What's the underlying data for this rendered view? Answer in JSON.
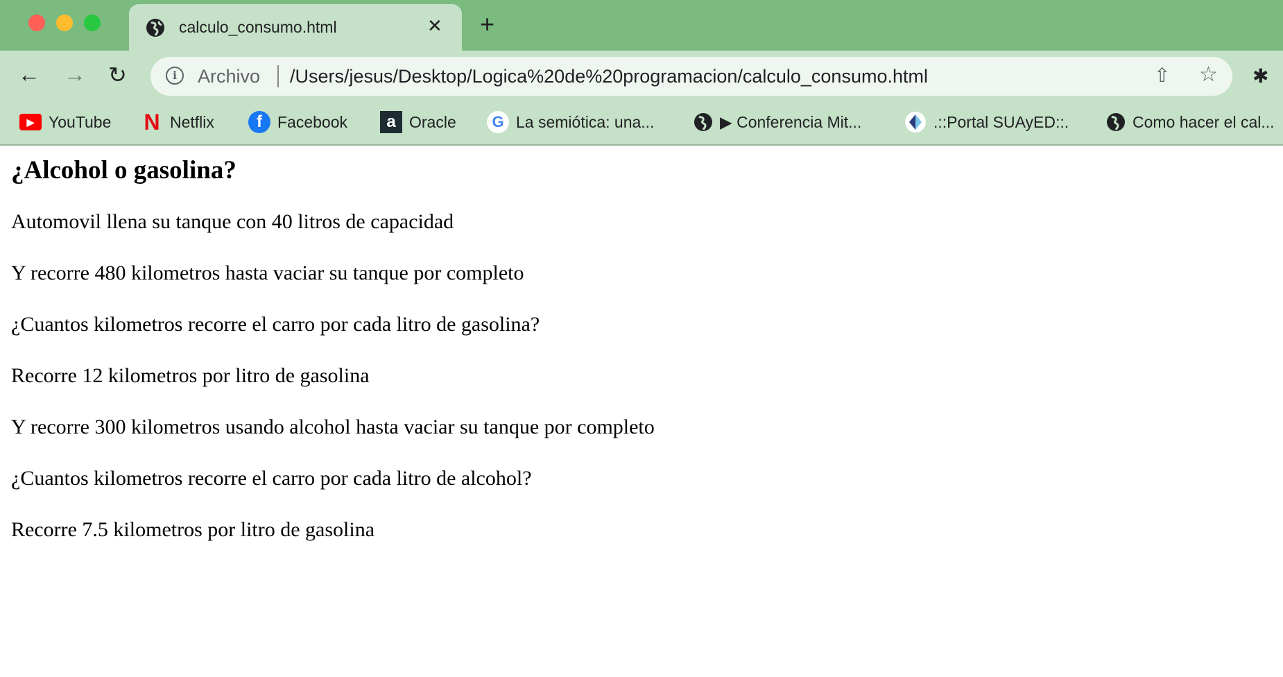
{
  "window": {
    "traffic_lights": {
      "close": "#fe5f57",
      "minimize": "#febc2e",
      "maximize": "#28c840"
    }
  },
  "tab": {
    "title": "calculo_consumo.html",
    "icon": "globe-icon",
    "close": "✕",
    "new_tab": "+"
  },
  "toolbar": {
    "back": "←",
    "forward": "→",
    "reload": "↻",
    "scheme_label": "Archivo",
    "url": "/Users/jesus/Desktop/Logica%20de%20programacion/calculo_consumo.html"
  },
  "bookmarks": [
    {
      "label": "YouTube",
      "icon": "youtube-icon"
    },
    {
      "label": "Netflix",
      "icon": "netflix-icon"
    },
    {
      "label": "Facebook",
      "icon": "facebook-icon"
    },
    {
      "label": "Oracle",
      "icon": "oracle-icon"
    },
    {
      "label": "La semiótica: una...",
      "icon": "google-icon"
    },
    {
      "label": "▶ Conferencia Mit...",
      "icon": "globe-icon"
    },
    {
      "label": ".::Portal SUAyED::.",
      "icon": "suayed-icon"
    },
    {
      "label": "Como hacer el cal...",
      "icon": "globe-icon"
    }
  ],
  "page": {
    "heading": "¿Alcohol o gasolina?",
    "paragraphs": [
      "Automovil llena su tanque con 40 litros de capacidad",
      "Y recorre 480 kilometros hasta vaciar su tanque por completo",
      "¿Cuantos kilometros recorre el carro por cada litro de gasolina?",
      "Recorre 12 kilometros por litro de gasolina",
      "Y recorre 300 kilometros usando alcohol hasta vaciar su tanque por completo",
      "¿Cuantos kilometros recorre el carro por cada litro de alcohol?",
      "Recorre 7.5 kilometros por litro de gasolina"
    ]
  }
}
